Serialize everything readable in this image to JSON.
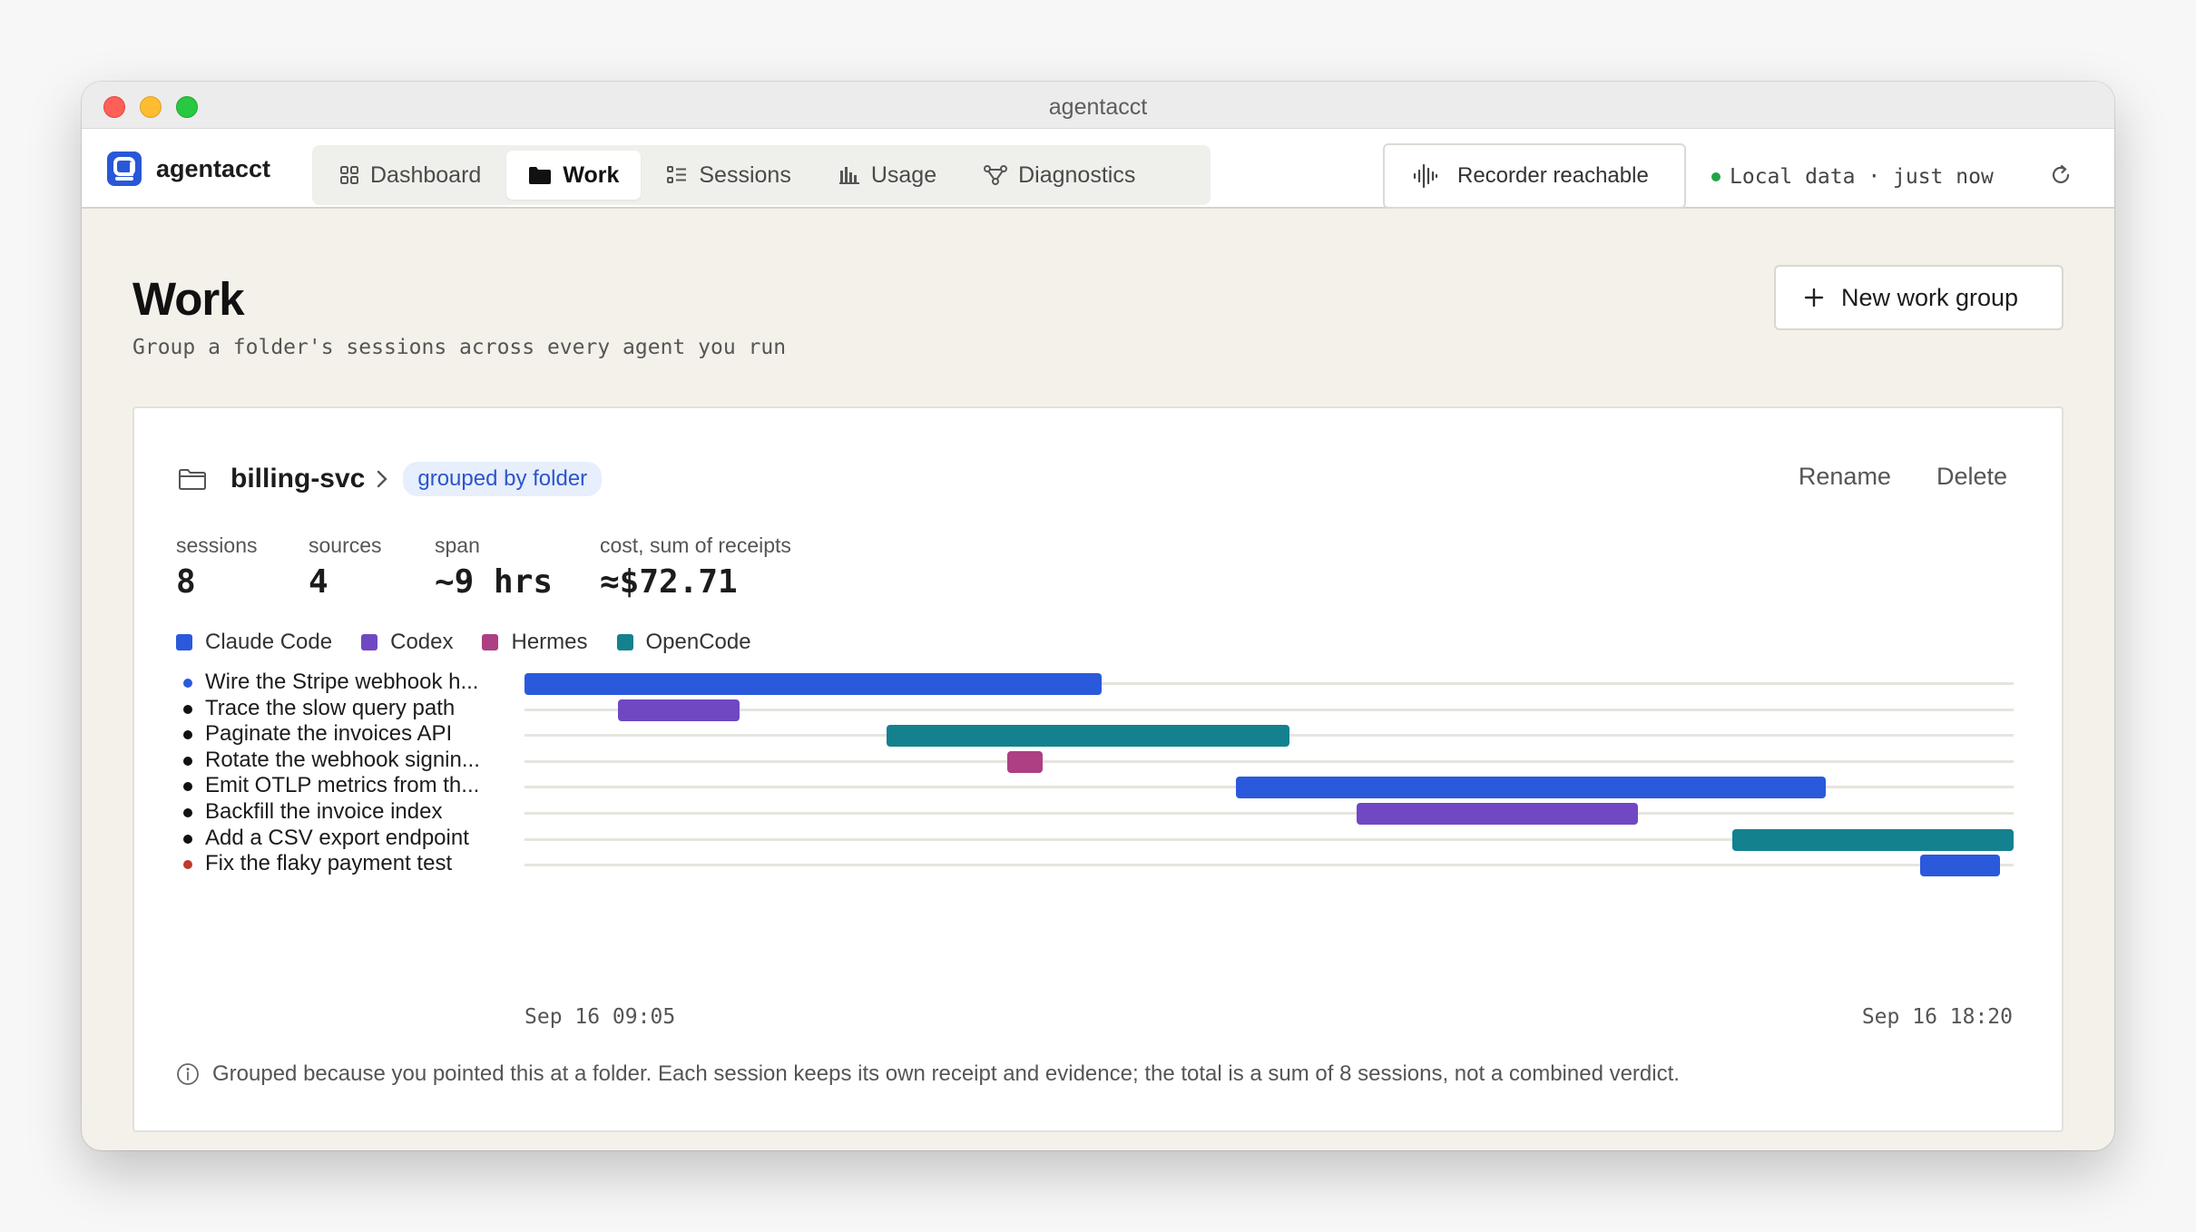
{
  "window": {
    "title": "agentacct"
  },
  "brand": {
    "name": "agentacct"
  },
  "nav": {
    "tabs": [
      {
        "label": "Dashboard",
        "icon": "grid-icon",
        "active": false
      },
      {
        "label": "Work",
        "icon": "folder-icon",
        "active": true
      },
      {
        "label": "Sessions",
        "icon": "list-icon",
        "active": false
      },
      {
        "label": "Usage",
        "icon": "bar-chart-icon",
        "active": false
      },
      {
        "label": "Diagnostics",
        "icon": "network-icon",
        "active": false
      }
    ]
  },
  "recorder": {
    "label": "Recorder reachable"
  },
  "status": {
    "text": "Local data · just now"
  },
  "page": {
    "title": "Work",
    "subtitle": "Group a folder's sessions across every agent you run",
    "new_button": "New work group"
  },
  "group": {
    "name": "billing-svc",
    "badge": "grouped by folder",
    "actions": {
      "rename": "Rename",
      "delete": "Delete"
    },
    "stats": [
      {
        "label": "sessions",
        "value": "8"
      },
      {
        "label": "sources",
        "value": "4"
      },
      {
        "label": "span",
        "value": "~9 hrs"
      },
      {
        "label": "cost, sum of receipts",
        "value": "≈$72.71"
      }
    ],
    "footnote": "Grouped because you pointed this at a folder. Each session keeps its own receipt and evidence; the total is a sum of 8 sessions, not a combined verdict."
  },
  "colors": {
    "Claude Code": "#2a59dc",
    "Codex": "#7048c2",
    "Hermes": "#ad3f83",
    "OpenCode": "#14818f",
    "status_ok": "#22a447",
    "status_error": "#c0392b"
  },
  "chart_data": {
    "type": "gantt",
    "x_start": "Sep 16 09:05",
    "x_end": "Sep 16 18:20",
    "axis_labels": [
      "Sep 16 09:05",
      "Sep 16 18:20"
    ],
    "legend": [
      "Claude Code",
      "Codex",
      "Hermes",
      "OpenCode"
    ],
    "sessions": [
      {
        "label": "Wire the Stripe webhook h...",
        "source": "Claude Code",
        "status": "active",
        "start": "09:05",
        "end": "12:40"
      },
      {
        "label": "Trace the slow query path",
        "source": "Codex",
        "status": "done",
        "start": "09:40",
        "end": "10:25"
      },
      {
        "label": "Paginate the invoices API",
        "source": "OpenCode",
        "status": "done",
        "start": "11:20",
        "end": "13:50"
      },
      {
        "label": "Rotate the webhook signin...",
        "source": "Hermes",
        "status": "done",
        "start": "12:05",
        "end": "12:18"
      },
      {
        "label": "Emit OTLP metrics from th...",
        "source": "Claude Code",
        "status": "done",
        "start": "13:30",
        "end": "17:10"
      },
      {
        "label": "Backfill the invoice index",
        "source": "Codex",
        "status": "done",
        "start": "14:15",
        "end": "16:00"
      },
      {
        "label": "Add a CSV export endpoint",
        "source": "OpenCode",
        "status": "done",
        "start": "16:35",
        "end": "18:20"
      },
      {
        "label": "Fix the flaky payment test",
        "source": "Claude Code",
        "status": "failed",
        "start": "17:45",
        "end": "18:15"
      }
    ]
  }
}
